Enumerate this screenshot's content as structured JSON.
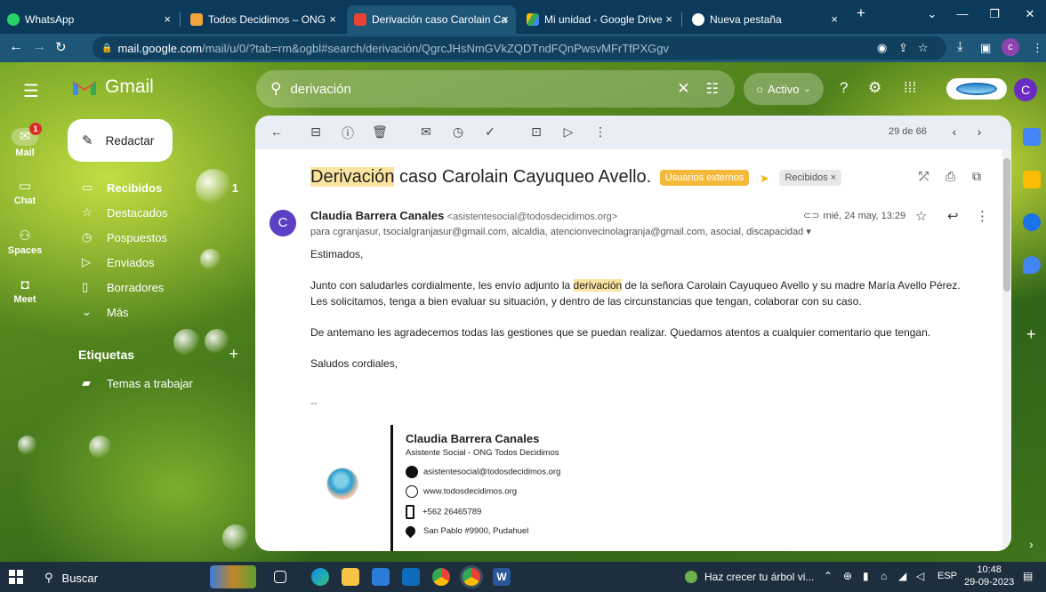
{
  "browser": {
    "tabs": [
      {
        "label": "WhatsApp",
        "color": "#25d366"
      },
      {
        "label": "Todos Decidimos – ONG",
        "color": "#f1a33c"
      },
      {
        "label": "Derivación caso Carolain Ca",
        "color": "#ea4335"
      },
      {
        "label": "Mi unidad - Google Drive",
        "color": "#fbbc04"
      },
      {
        "label": "Nueva pestaña",
        "color": "#ffffff"
      }
    ],
    "new_tab": "+",
    "close": "×",
    "url_host": "mail.google.com",
    "url_path": "/mail/u/0/?tab=rm&ogbl#search/derivación/QgrcJHsNmGVkZQDTndFQnPwsvMFrTfPXGgv"
  },
  "gmail": {
    "logo_text": "Gmail",
    "search_value": "derivación",
    "status_label": "Activo",
    "compose_label": "Redactar",
    "rail": [
      {
        "label": "Mail",
        "icon": "mail-icon",
        "badge": "1"
      },
      {
        "label": "Chat",
        "icon": "chat-icon"
      },
      {
        "label": "Spaces",
        "icon": "spaces-icon"
      },
      {
        "label": "Meet",
        "icon": "meet-icon"
      }
    ],
    "folders": [
      {
        "label": "Recibidos",
        "count": "1",
        "icon": "inbox-icon"
      },
      {
        "label": "Destacados",
        "icon": "star-icon"
      },
      {
        "label": "Pospuestos",
        "icon": "clock-icon"
      },
      {
        "label": "Enviados",
        "icon": "send-icon"
      },
      {
        "label": "Borradores",
        "icon": "draft-icon"
      },
      {
        "label": "Más",
        "icon": "chevron-down-icon"
      }
    ],
    "labels_title": "Etiquetas",
    "labels": [
      {
        "label": "Temas a trabajar"
      }
    ],
    "toolbar": {
      "pagination": "29 de 66"
    }
  },
  "email": {
    "subject_highlight": "Derivación",
    "subject_rest": " caso Carolain Cayuqueo Avello.",
    "tag_external": "Usuarios externos",
    "tag_inbox": "Recibidos ×",
    "sender_initial": "C",
    "sender_name": "Claudia Barrera Canales",
    "sender_email": "<asistentesocial@todosdecidimos.org>",
    "date": "mié, 24 may, 13:29",
    "recipients": "para cgranjasur, tsocialgranjasur@gmail.com, alcaldia, atencionvecinolagranja@gmail.com, asocial, discapacidad",
    "greeting": "Estimados,",
    "p1_before": "Junto con saludarles cordialmente, les envío adjunto la ",
    "p1_highlight": "derivación",
    "p1_after": " de la señora Carolain Cayuqueo Avello y su madre María Avello Pérez.",
    "p1_line2": "Les solicitamos, tenga a bien evaluar su situación, y dentro de las circunstancias que tengan, colaborar con su caso.",
    "p2": "De antemano les agradecemos todas las gestiones que se puedan realizar. Quedamos atentos a cualquier comentario que tengan.",
    "closing": "Saludos cordiales,",
    "sig_sep": "--",
    "signature": {
      "name": "Claudia Barrera Canales",
      "role": "Asistente Social - ONG Todos Decidimos",
      "email": "asistentesocial@todosdecidimos.org",
      "web": "www.todosdecidimos.org",
      "phone": "+562 26465789",
      "address": "San Pablo #9900, Pudahuel"
    }
  },
  "taskbar": {
    "search_label": "Buscar",
    "news": "Haz crecer tu árbol vi...",
    "lang": "ESP",
    "time": "10:48",
    "date": "29-09-2023"
  }
}
